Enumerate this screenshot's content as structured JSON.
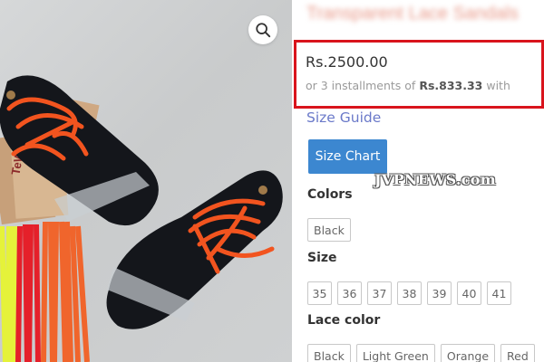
{
  "product": {
    "title_blurred": "Transparent Lace Sandals",
    "price": "Rs.2500.00",
    "installments": {
      "prefix": "or 3 installments of",
      "amount": "Rs.833.33",
      "suffix": "with"
    },
    "size_guide_label": "Size Guide",
    "size_chart_label": "Size Chart",
    "colors_label": "Colors",
    "colors": [
      "Black"
    ],
    "size_label": "Size",
    "sizes": [
      "35",
      "36",
      "37",
      "38",
      "39",
      "40",
      "41"
    ],
    "lace_color_label": "Lace color",
    "lace_colors": [
      "Black",
      "Light Green",
      "Orange",
      "Red"
    ]
  },
  "image": {
    "zoom_icon": "search-icon",
    "tag_text": "TeW"
  },
  "watermark": "JVPNEWS.com",
  "colors": {
    "highlight_border": "#d9141c",
    "button_blue": "#3c87d0",
    "link": "#6a79c9",
    "lace_orange": "#f2541f",
    "sole_black": "#14161b"
  }
}
